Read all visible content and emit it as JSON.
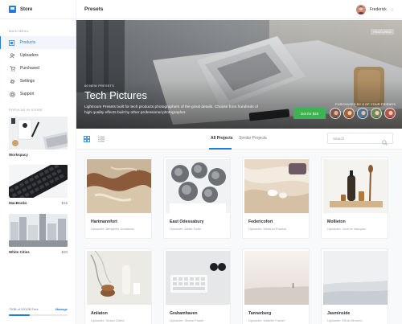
{
  "sidebar": {
    "brand": "Store",
    "menu_title": "MAIN MENU",
    "items": [
      {
        "label": "Products",
        "icon": "grid-icon"
      },
      {
        "label": "Uploaders",
        "icon": "users-icon"
      },
      {
        "label": "Purchased",
        "icon": "cart-icon"
      },
      {
        "label": "Settings",
        "icon": "gear-icon"
      },
      {
        "label": "Support",
        "icon": "help-icon"
      }
    ],
    "popular_title": "POPULAR IN STORE",
    "popular": [
      {
        "name": "Workspacy",
        "price": ""
      },
      {
        "name": "MacBooks",
        "price": "$15"
      },
      {
        "name": "White Cities",
        "price": "$20"
      }
    ],
    "storage": {
      "text": "750B of 320GB Free",
      "manage": "Manage",
      "used_fraction": 0.35
    }
  },
  "header": {
    "title": "Presets",
    "user_name": "Frederick"
  },
  "hero": {
    "featured": "FEATURED",
    "small": "60 NEW PRESETS",
    "title": "Tech Pictures",
    "description": "Lightroom Presets built for tech products photographers of the great details. Choose from hundreds of high quality effects built by other professional photographer.",
    "button": "Get for $40",
    "friends_label": "PURCHASED BY 8 OF YOUR FRIENDS"
  },
  "toolbar": {
    "tabs": [
      "All Projects",
      "Similar Projects"
    ],
    "search_placeholder": "Search"
  },
  "cards": [
    {
      "title": "Hartmannfort",
      "uploader": "Uploader: Benjamin Goodman"
    },
    {
      "title": "East Odessabury",
      "uploader": "Uploader: Addie Fuller"
    },
    {
      "title": "Federicofort",
      "uploader": "Uploader: Minerva Powers"
    },
    {
      "title": "Mollieton",
      "uploader": "Uploader: Jerome Vasquez"
    },
    {
      "title": "Aniiaton",
      "uploader": "Uploader: Susan Gibbs"
    },
    {
      "title": "Grahamhaven",
      "uploader": "Uploader: Shane Fraser"
    },
    {
      "title": "Tannerberg",
      "uploader": "Uploader: Isabelle Fowler"
    },
    {
      "title": "Jasminside",
      "uploader": "Uploader: Ethan Moreno"
    }
  ],
  "colors": {
    "accent": "#1a7fe0",
    "cta": "#3fb34f"
  }
}
